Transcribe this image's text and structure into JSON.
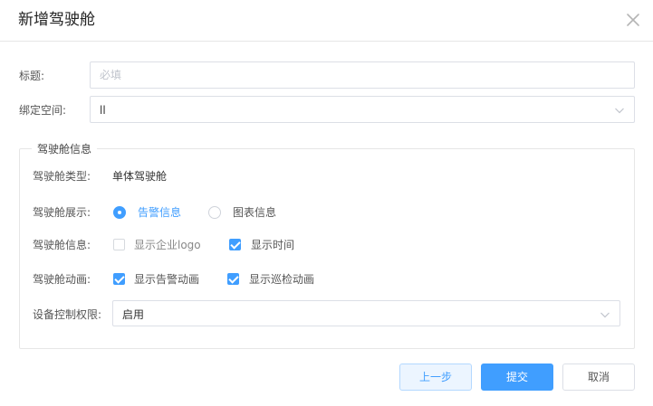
{
  "dialog": {
    "title": "新增驾驶舱",
    "close_icon": "close-icon"
  },
  "form": {
    "title_label": "标题:",
    "title_placeholder": "必填",
    "title_value": "",
    "space_label": "绑定空间:",
    "space_value": "ll"
  },
  "cockpit_info": {
    "legend": "驾驶舱信息",
    "type_label": "驾驶舱类型:",
    "type_value": "单体驾驶舱",
    "display_label": "驾驶舱展示:",
    "display_options": [
      {
        "label": "告警信息",
        "checked": true
      },
      {
        "label": "图表信息",
        "checked": false
      }
    ],
    "info_label": "驾驶舱信息:",
    "info_options": [
      {
        "label": "显示企业logo",
        "checked": false,
        "disabled": true
      },
      {
        "label": "显示时间",
        "checked": true
      }
    ],
    "animation_label": "驾驶舱动画:",
    "animation_options": [
      {
        "label": "显示告警动画",
        "checked": true
      },
      {
        "label": "显示巡检动画",
        "checked": true
      }
    ],
    "permission_label": "设备控制权限:",
    "permission_value": "启用"
  },
  "footer": {
    "prev_label": "上一步",
    "submit_label": "提交",
    "cancel_label": "取消"
  },
  "colors": {
    "accent": "#409eff",
    "border": "#dcdfe6"
  }
}
